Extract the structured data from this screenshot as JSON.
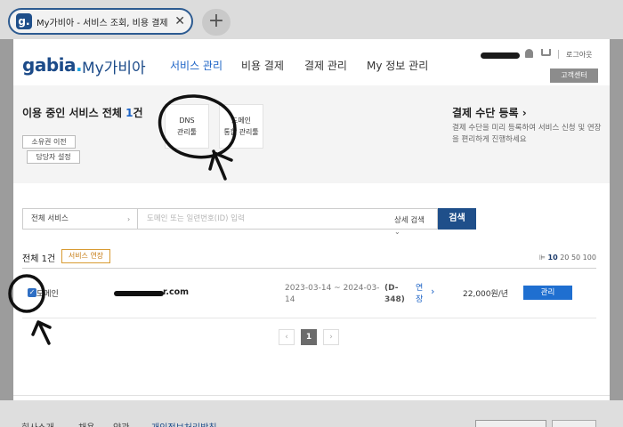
{
  "browser": {
    "tab_favicon": "g.",
    "tab_title": "My가비아 - 서비스 조회, 비용 결제, ...",
    "tab_close": "✕",
    "new_tab": "+"
  },
  "header": {
    "logo": "gabia",
    "logo_dot": ".",
    "logo_sub": "My가비아",
    "nav": [
      "서비스 관리",
      "비용 결제",
      "결제 관리",
      "My 정보 관리"
    ],
    "logout": "로그아웃",
    "support": "고객센터"
  },
  "summary": {
    "title_prefix": "이용 중인 서비스 전체 ",
    "count": "1",
    "title_suffix": "건",
    "chip_transfer": "소유권 이전",
    "chip_manager": "담당자 설정",
    "dns_tool": [
      "DNS",
      "관리툴"
    ],
    "domain_tool": [
      "도메인",
      "통합 관리툴"
    ],
    "payment_title": "결제 수단 등록 ›",
    "payment_desc": "결제 수단을 미리 등록하여 서비스 신청 및 연장을 편리하게 진행하세요"
  },
  "search": {
    "select_value": "전체 서비스",
    "placeholder": "도메인 또는 일련번호(ID) 입력",
    "detail": "상세 검색",
    "button": "검색"
  },
  "list": {
    "total": "전체 1건",
    "renew_badge": "서비스 연장",
    "page_sizes": [
      "10",
      "20",
      "50",
      "100"
    ],
    "rows": [
      {
        "type": "도메인",
        "domain_suffix": "r.com",
        "period": "2023-03-14 ~ 2024-03-14",
        "dday": "(D-348)",
        "renew": "연장",
        "price": "22,000원/년",
        "action": "관리",
        "checked": true
      }
    ]
  },
  "pagination": {
    "prev": "‹",
    "current": "1",
    "next": "›"
  },
  "footer": {
    "links": [
      "회사소개",
      "채용",
      "약관",
      "개인정보처리방침"
    ]
  }
}
